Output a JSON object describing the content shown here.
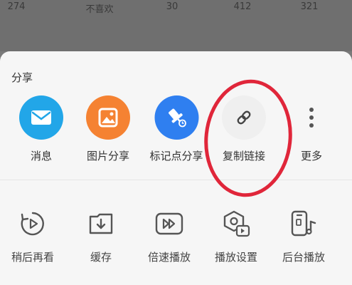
{
  "top_stats": [
    "274",
    "不喜欢",
    "30",
    "412",
    "321"
  ],
  "share": {
    "title": "分享",
    "items": [
      {
        "label": "消息",
        "icon": "mail-icon",
        "color": "#22a6e8"
      },
      {
        "label": "图片分享",
        "icon": "image-icon",
        "color": "#f58232"
      },
      {
        "label": "标记点分享",
        "icon": "pin-icon",
        "color": "#2f7ff0"
      },
      {
        "label": "复制链接",
        "icon": "link-icon",
        "color": "#efefef"
      },
      {
        "label": "更多",
        "icon": "more-dots-icon",
        "color": "#efefef"
      }
    ]
  },
  "actions": [
    {
      "label": "稍后再看",
      "icon": "watch-later-icon"
    },
    {
      "label": "缓存",
      "icon": "download-cache-icon"
    },
    {
      "label": "倍速播放",
      "icon": "speed-play-icon"
    },
    {
      "label": "播放设置",
      "icon": "play-settings-icon"
    },
    {
      "label": "后台播放",
      "icon": "background-play-icon"
    }
  ],
  "annotation_color": "#e0263a"
}
